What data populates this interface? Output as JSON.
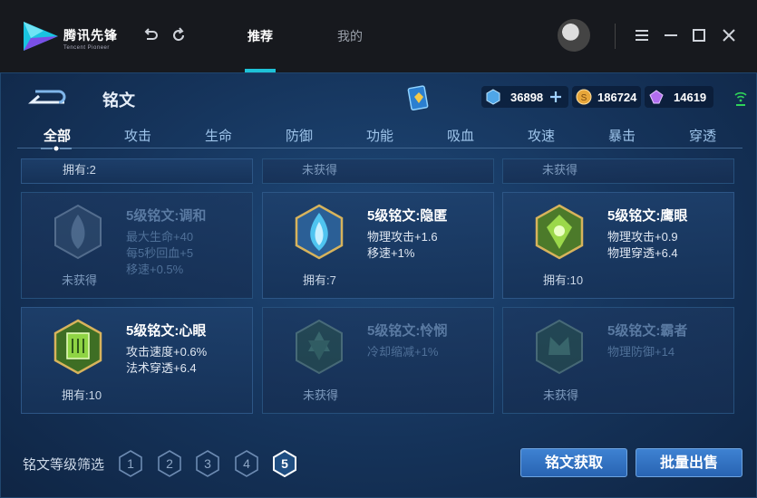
{
  "app": {
    "logo_cn": "腾讯先锋",
    "logo_en": "Tencent Pioneer",
    "nav": [
      "推荐",
      "我的"
    ],
    "active_nav": 0
  },
  "header": {
    "title": "铭文",
    "currencies": [
      {
        "icon": "diamond-icon",
        "value": "36898"
      },
      {
        "icon": "gold-coin-icon",
        "value": "186724"
      },
      {
        "icon": "purple-crystal-icon",
        "value": "14619"
      }
    ]
  },
  "tabs": [
    "全部",
    "攻击",
    "生命",
    "防御",
    "功能",
    "吸血",
    "攻速",
    "暴击",
    "穿透"
  ],
  "active_tab": 0,
  "partial_cards": [
    {
      "own": "拥有:2"
    },
    {
      "own": "未获得"
    },
    {
      "own": "未获得"
    }
  ],
  "cards": [
    {
      "name": "5级铭文:调和",
      "attrs": [
        "最大生命+40",
        "每5秒回血+5",
        "移速+0.5%"
      ],
      "own": "未获得",
      "owned": false,
      "color": "#6c8fb8"
    },
    {
      "name": "5级铭文:隐匿",
      "attrs": [
        "物理攻击+1.6",
        "移速+1%"
      ],
      "own": "拥有:7",
      "owned": true,
      "color": "#3fb4e8"
    },
    {
      "name": "5级铭文:鹰眼",
      "attrs": [
        "物理攻击+0.9",
        "物理穿透+6.4"
      ],
      "own": "拥有:10",
      "owned": true,
      "color": "#8ccd3c"
    },
    {
      "name": "5级铭文:心眼",
      "attrs": [
        "攻击速度+0.6%",
        "法术穿透+6.4"
      ],
      "own": "拥有:10",
      "owned": true,
      "color": "#7cc83a"
    },
    {
      "name": "5级铭文:怜悯",
      "attrs": [
        "冷却缩减+1%"
      ],
      "own": "未获得",
      "owned": false,
      "color": "#4e9a6a"
    },
    {
      "name": "5级铭文:霸者",
      "attrs": [
        "物理防御+14"
      ],
      "own": "未获得",
      "owned": false,
      "color": "#4e9a6a"
    }
  ],
  "footer": {
    "filter_label": "铭文等级筛选",
    "levels": [
      "1",
      "2",
      "3",
      "4",
      "5"
    ],
    "active_level": "5",
    "get_button": "铭文获取",
    "sell_button": "批量出售"
  },
  "colors": {
    "accent": "#1ec2d8",
    "button": "#3a7ccc",
    "bg": "#17325a"
  }
}
